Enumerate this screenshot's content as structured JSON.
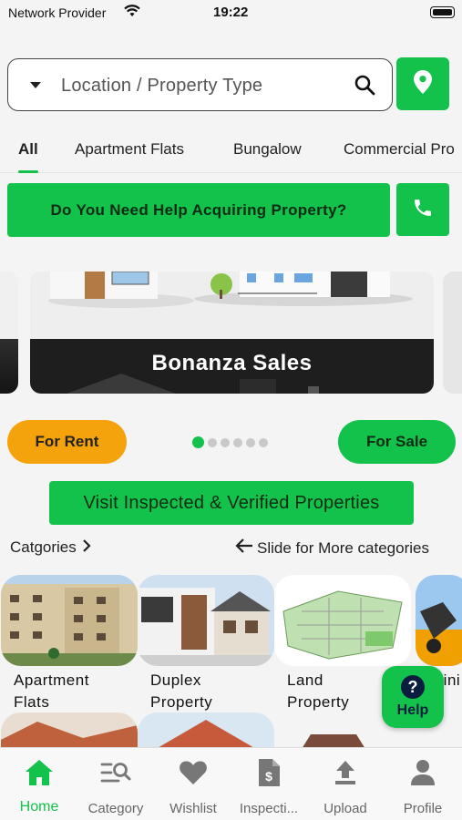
{
  "status": {
    "carrier": "Network Provider",
    "time": "19:22"
  },
  "search": {
    "placeholder": "Location / Property Type"
  },
  "tabs": [
    {
      "label": "All"
    },
    {
      "label": "Apartment Flats"
    },
    {
      "label": "Bungalow"
    },
    {
      "label": "Commercial Pro"
    }
  ],
  "banner": {
    "help_text": "Do You Need Help Acquiring Property?"
  },
  "carousel": {
    "title": "Bonanza Sales",
    "slide_count": 6,
    "active_index": 0
  },
  "actions": {
    "rent": "For Rent",
    "sale": "For Sale",
    "verified": "Visit Inspected & Verified Properties"
  },
  "categories": {
    "heading": "Catgories",
    "hint": "Slide for More categories",
    "items": [
      {
        "line1": "Apartment",
        "line2": "Flats"
      },
      {
        "line1": "Duplex",
        "line2": "Property"
      },
      {
        "line1": "Land",
        "line2": "Property"
      },
      {
        "line1": "Mini",
        "line2": ""
      }
    ]
  },
  "fab": {
    "label": "Help"
  },
  "nav": [
    {
      "label": "Home",
      "icon": "home-icon"
    },
    {
      "label": "Category",
      "icon": "category-search-icon"
    },
    {
      "label": "Wishlist",
      "icon": "heart-icon"
    },
    {
      "label": "Inspecti...",
      "icon": "document-dollar-icon"
    },
    {
      "label": "Upload",
      "icon": "upload-icon"
    },
    {
      "label": "Profile",
      "icon": "profile-icon"
    }
  ],
  "colors": {
    "accent": "#12c24a",
    "rent": "#f5a30c",
    "fab_text": "#0b1e3f"
  }
}
